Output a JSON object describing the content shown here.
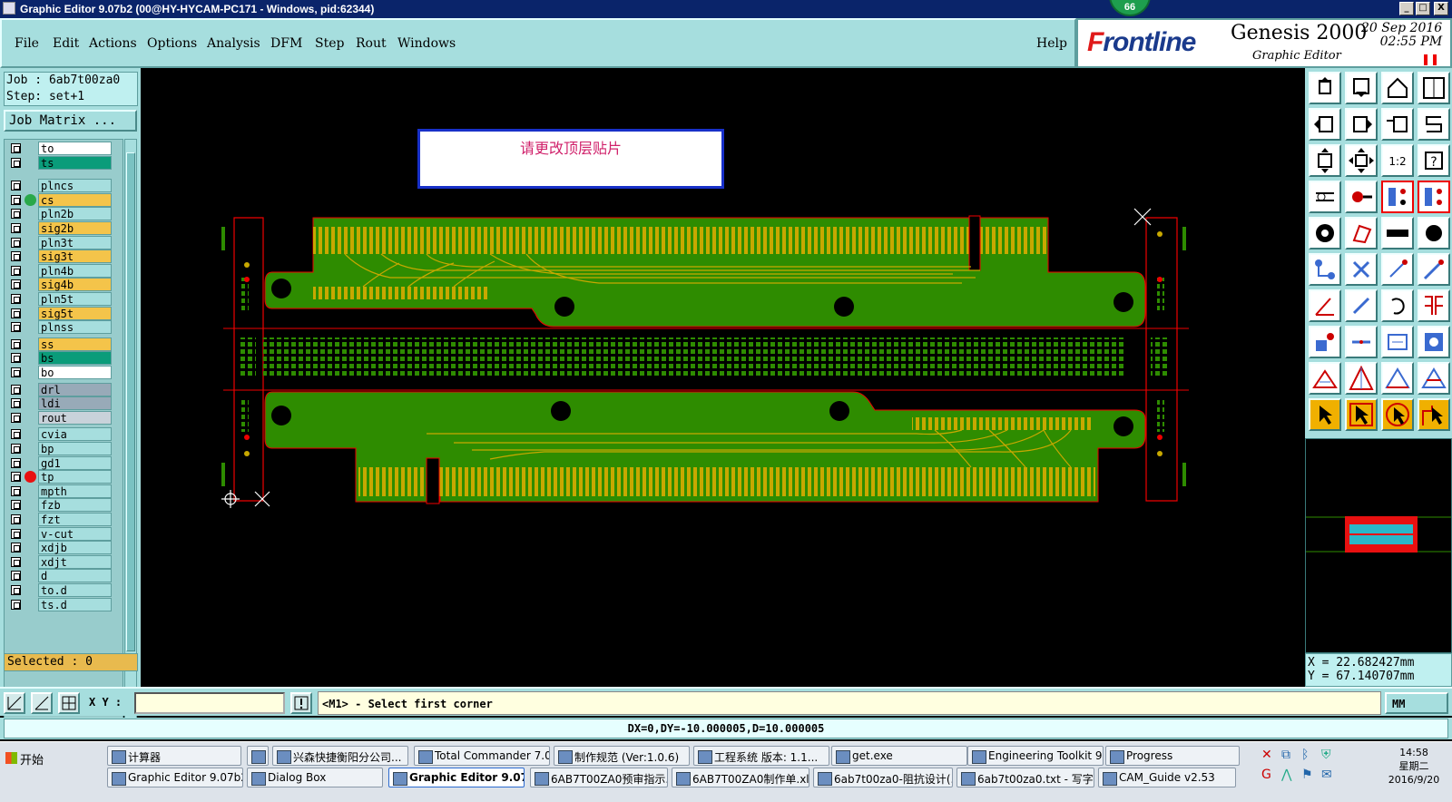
{
  "window": {
    "title": "Graphic Editor 9.07b2 (00@HY-HYCAM-PC171 - Windows, pid:62344)",
    "badge": "66",
    "min": "_",
    "max": "□",
    "close": "X"
  },
  "menu": {
    "items": [
      "File",
      "Edit",
      "Actions",
      "Options",
      "Analysis",
      "DFM",
      "Step",
      "Rout",
      "Windows"
    ],
    "help": "Help"
  },
  "brand": {
    "logo_f": "F",
    "logo_rest": "rontline",
    "product": "Genesis 2000",
    "subtitle": "Graphic Editor",
    "date": "20 Sep 2016",
    "time": "02:55 PM"
  },
  "job": {
    "job_line": "Job : 6ab7t00za0",
    "step_line": "Step: set+1",
    "matrix_button": "Job Matrix ..."
  },
  "layers": [
    {
      "name": "to",
      "color": "#ffffff",
      "dot": ""
    },
    {
      "name": "ts",
      "color": "#0a9c7a",
      "dot": ""
    },
    {
      "name": "plncs",
      "color": "#a6dede",
      "dot": ""
    },
    {
      "name": "cs",
      "color": "#f4c44a",
      "dot": "#2aa84a"
    },
    {
      "name": "pln2b",
      "color": "#a6dede",
      "dot": ""
    },
    {
      "name": "sig2b",
      "color": "#f4c44a",
      "dot": ""
    },
    {
      "name": "pln3t",
      "color": "#a6dede",
      "dot": ""
    },
    {
      "name": "sig3t",
      "color": "#f4c44a",
      "dot": ""
    },
    {
      "name": "pln4b",
      "color": "#a6dede",
      "dot": ""
    },
    {
      "name": "sig4b",
      "color": "#f4c44a",
      "dot": ""
    },
    {
      "name": "pln5t",
      "color": "#a6dede",
      "dot": ""
    },
    {
      "name": "sig5t",
      "color": "#f4c44a",
      "dot": ""
    },
    {
      "name": "plnss",
      "color": "#a6dede",
      "dot": ""
    },
    {
      "name": "ss",
      "color": "#f4c44a",
      "dot": ""
    },
    {
      "name": "bs",
      "color": "#0a9c7a",
      "dot": ""
    },
    {
      "name": "bo",
      "color": "#ffffff",
      "dot": ""
    },
    {
      "name": "drl",
      "color": "#98aab8",
      "dot": ""
    },
    {
      "name": "ldi",
      "color": "#98aab8",
      "dot": ""
    },
    {
      "name": "rout",
      "color": "#c8d2da",
      "dot": ""
    },
    {
      "name": "cvia",
      "color": "#a6dede",
      "dot": ""
    },
    {
      "name": "bp",
      "color": "#a6dede",
      "dot": ""
    },
    {
      "name": "gd1",
      "color": "#a6dede",
      "dot": ""
    },
    {
      "name": "tp",
      "color": "#a6dede",
      "dot": "#e81010"
    },
    {
      "name": "mpth",
      "color": "#a6dede",
      "dot": ""
    },
    {
      "name": "fzb",
      "color": "#a6dede",
      "dot": ""
    },
    {
      "name": "fzt",
      "color": "#a6dede",
      "dot": ""
    },
    {
      "name": "v-cut",
      "color": "#a6dede",
      "dot": ""
    },
    {
      "name": "xdjb",
      "color": "#a6dede",
      "dot": ""
    },
    {
      "name": "xdjt",
      "color": "#a6dede",
      "dot": ""
    },
    {
      "name": "d",
      "color": "#a6dede",
      "dot": ""
    },
    {
      "name": "to.d",
      "color": "#a6dede",
      "dot": ""
    },
    {
      "name": "ts.d",
      "color": "#a6dede",
      "dot": ""
    }
  ],
  "selected": "Selected : 0",
  "message": "请更改顶层贴片",
  "toolbox": {
    "ratio_label": "1:2",
    "help_label": "?"
  },
  "coords": {
    "x": "X = 22.682427mm",
    "y": "Y = 67.140707mm"
  },
  "cmd": {
    "xy_label": "X Y :",
    "xy_value": "",
    "prompt": "<M1> - Select first corner",
    "units": "MM"
  },
  "status": "DX=0,DY=-10.000005,D=10.000005",
  "taskbar": {
    "start": "开始",
    "row1": [
      "计算器",
      "",
      "兴森快捷衡阳分公司...",
      "Total Commander 7.0 ...",
      "制作规范 (Ver:1.0.6)",
      "工程系统 版本: 1.1...",
      "get.exe",
      "Engineering Toolkit 9.0...",
      "Progress"
    ],
    "row2": [
      "Graphic Editor 9.07b2 (...",
      "Dialog Box",
      "Graphic Editor 9.07b...",
      "6AB7T00ZA0预审指示....",
      "6AB7T00ZA0制作单.xls...",
      "6ab7t00za0-阻抗设计(...",
      "6ab7t00za0.txt - 写字板",
      "CAM_Guide v2.53"
    ],
    "time": "14:58",
    "weekday": "星期二",
    "date": "2016/9/20"
  },
  "colors": {
    "board": "#2e8c00",
    "copper": "#c8a800",
    "outline": "#e00000",
    "drill": "#000000"
  }
}
